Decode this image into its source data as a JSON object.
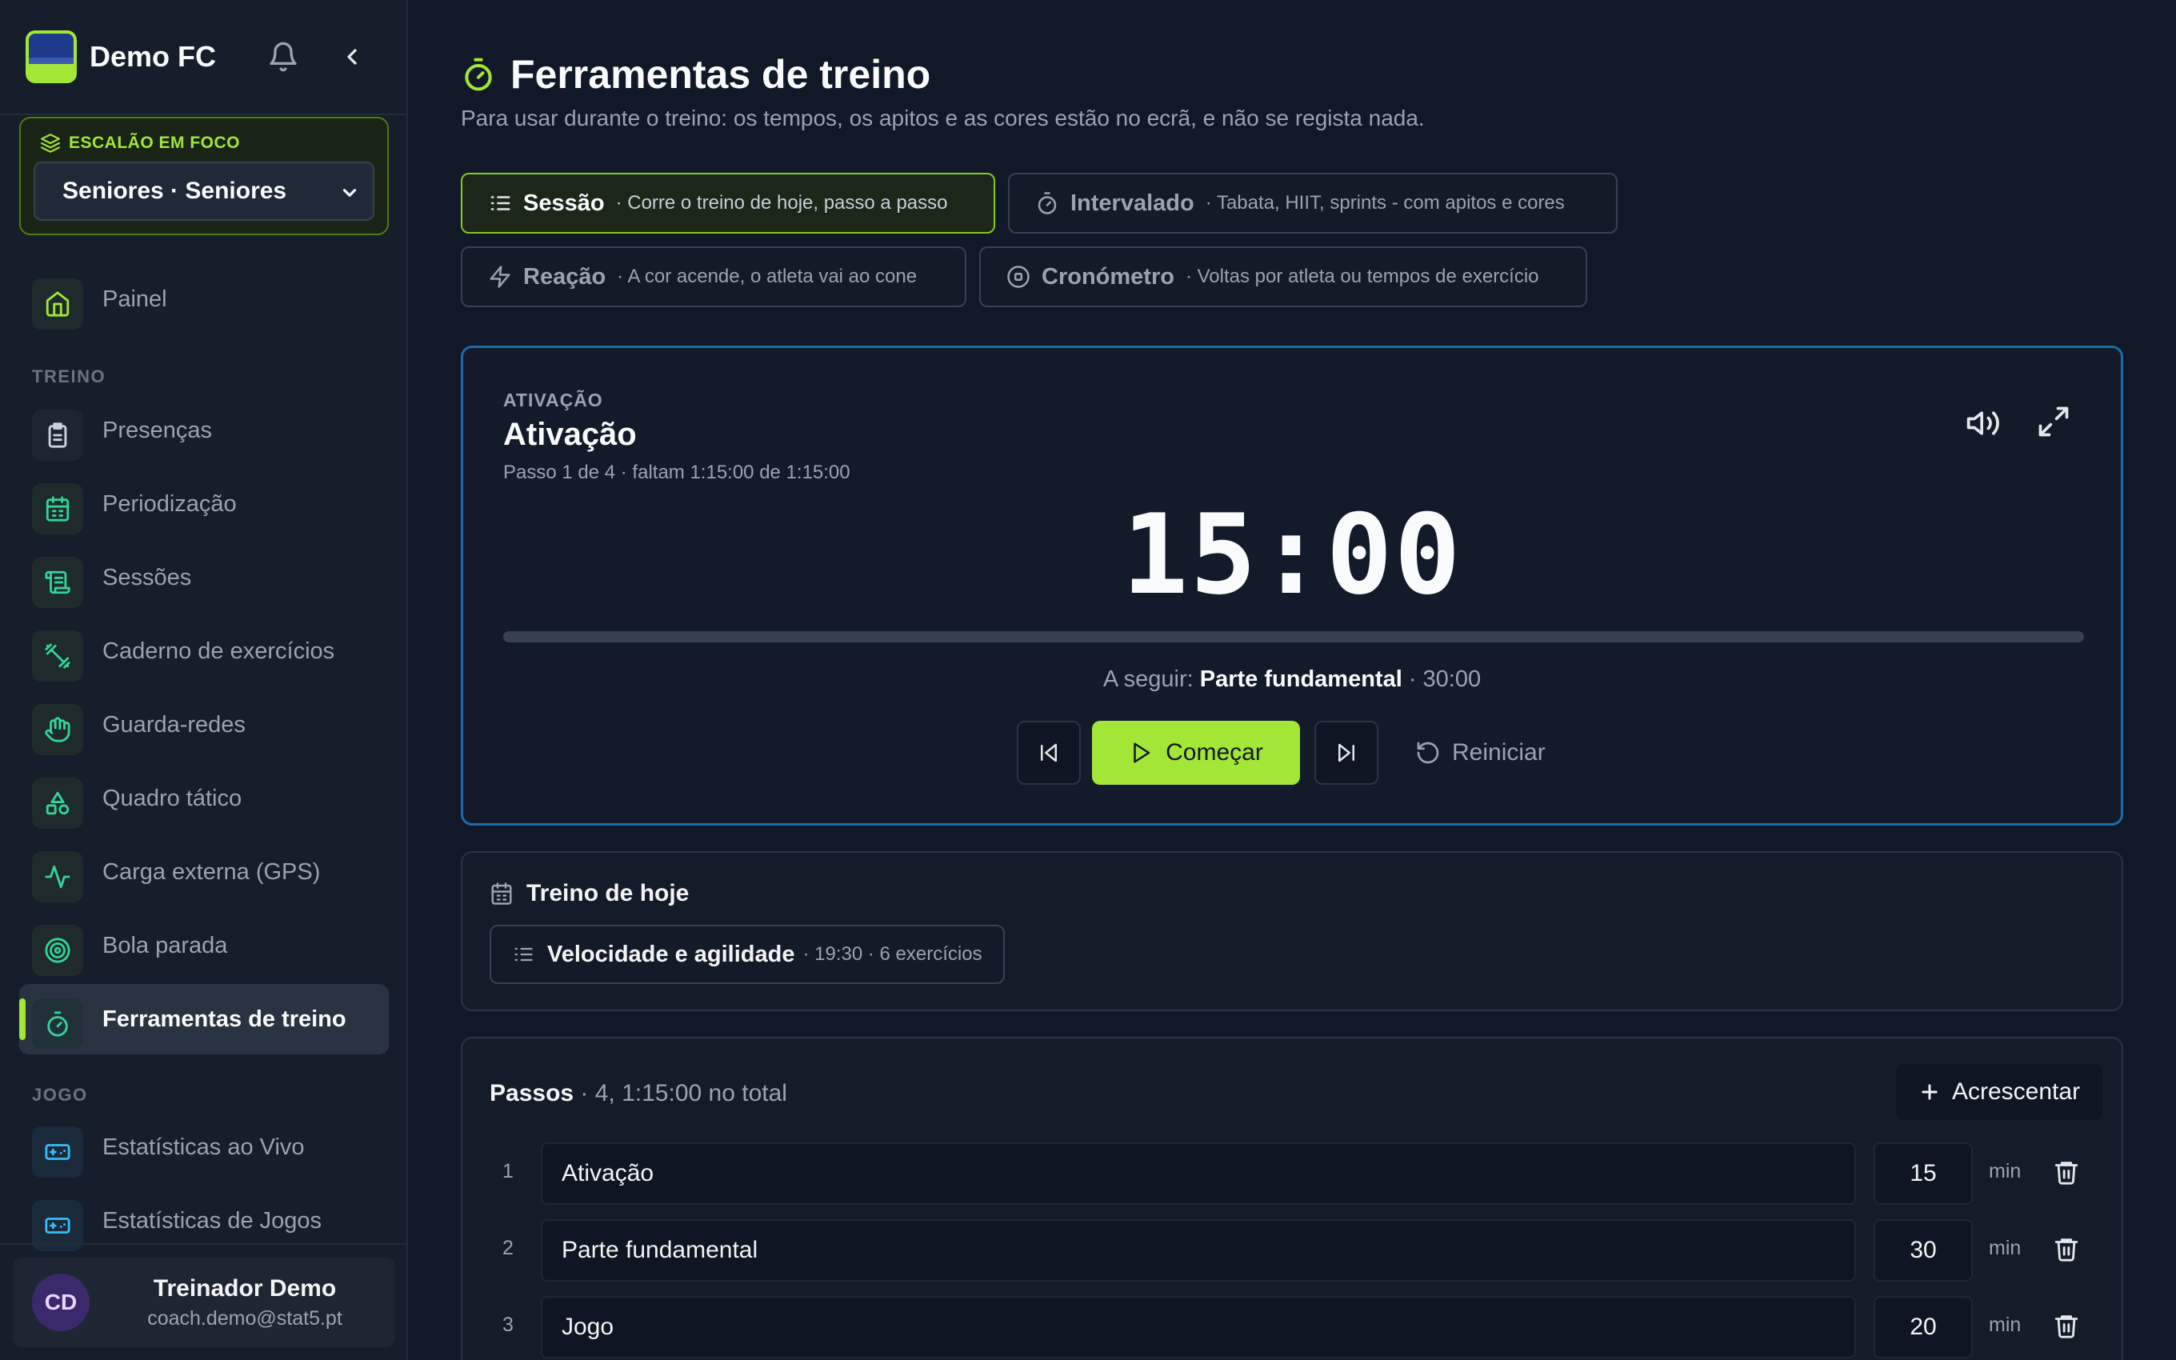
{
  "app": {
    "brand": "Demo FC"
  },
  "focus": {
    "label": "ESCALÃO EM FOCO",
    "selected": "Seniores · Seniores"
  },
  "nav": {
    "top": [
      {
        "label": "Painel"
      }
    ],
    "section_treino": "TREINO",
    "treino": [
      {
        "label": "Presenças"
      },
      {
        "label": "Periodização"
      },
      {
        "label": "Sessões"
      },
      {
        "label": "Caderno de exercícios"
      },
      {
        "label": "Guarda-redes"
      },
      {
        "label": "Quadro tático"
      },
      {
        "label": "Carga externa (GPS)"
      },
      {
        "label": "Bola parada"
      },
      {
        "label": "Ferramentas de treino"
      }
    ],
    "section_jogo": "JOGO",
    "jogo": [
      {
        "label": "Estatísticas ao Vivo"
      },
      {
        "label": "Estatísticas de Jogos"
      }
    ]
  },
  "user": {
    "initials": "CD",
    "name": "Treinador Demo",
    "email": "coach.demo@stat5.pt"
  },
  "page": {
    "title": "Ferramentas de treino",
    "subtitle": "Para usar durante o treino: os tempos, os apitos e as cores estão no ecrã, e não se regista nada."
  },
  "tabs": [
    {
      "name": "Sessão",
      "desc": "· Corre o treino de hoje, passo a passo"
    },
    {
      "name": "Intervalado",
      "desc": "· Tabata, HIIT, sprints - com apitos e cores"
    },
    {
      "name": "Reação",
      "desc": "· A cor acende, o atleta vai ao cone"
    },
    {
      "name": "Cronómetro",
      "desc": "· Voltas por atleta ou tempos de exercício"
    }
  ],
  "timer": {
    "tag": "ATIVAÇÃO",
    "title": "Ativação",
    "meta": "Passo 1 de 4 · faltam 1:15:00 de 1:15:00",
    "time": "15:00",
    "progress": 0,
    "next_prefix": "A seguir:",
    "next_name": "Parte fundamental",
    "next_time": "· 30:00",
    "start_label": "Começar",
    "reset_label": "Reiniciar"
  },
  "today": {
    "heading": "Treino de hoje",
    "item_name": "Velocidade e agilidade",
    "item_meta": "· 19:30 · 6 exercícios"
  },
  "steps": {
    "heading": "Passos",
    "summary": "· 4, 1:15:00 no total",
    "add_label": "Acrescentar",
    "unit": "min",
    "rows": [
      {
        "num": "1",
        "name": "Ativação",
        "minutes": "15"
      },
      {
        "num": "2",
        "name": "Parte fundamental",
        "minutes": "30"
      },
      {
        "num": "3",
        "name": "Jogo",
        "minutes": "20"
      }
    ]
  },
  "colors": {
    "accent": "#a3e635",
    "focus_border": "#1e6aa8",
    "bg": "#111827"
  }
}
